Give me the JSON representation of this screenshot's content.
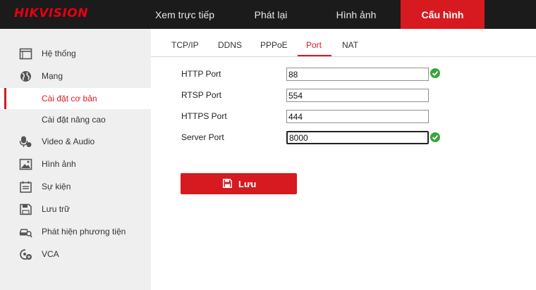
{
  "brand": {
    "logo_text_a": "HIK",
    "logo_text_b": "VISION",
    "accent": "#d71920"
  },
  "topnav": [
    {
      "label": "Xem trực tiếp",
      "active": false
    },
    {
      "label": "Phát lại",
      "active": false
    },
    {
      "label": "Hình ảnh",
      "active": false
    },
    {
      "label": "Cấu hình",
      "active": true
    }
  ],
  "sidebar": {
    "items": [
      {
        "label": "Hệ thống",
        "icon": "system-monitor-icon"
      },
      {
        "label": "Mạng",
        "icon": "globe-icon"
      },
      {
        "label": "Cài đặt cơ bản",
        "icon": "",
        "selected": true
      },
      {
        "label": "Cài đặt nâng cao",
        "icon": ""
      },
      {
        "label": "Video & Audio",
        "icon": "microphone-camera-icon"
      },
      {
        "label": "Hình ảnh",
        "icon": "image-icon"
      },
      {
        "label": "Sự kiện",
        "icon": "calendar-icon"
      },
      {
        "label": "Lưu trữ",
        "icon": "floppy-disk-icon"
      },
      {
        "label": "Phát hiện phương tiện",
        "icon": "car-search-icon"
      },
      {
        "label": "VCA",
        "icon": "vca-settings-icon"
      }
    ]
  },
  "tabs": [
    {
      "label": "TCP/IP",
      "active": false
    },
    {
      "label": "DDNS",
      "active": false
    },
    {
      "label": "PPPoE",
      "active": false
    },
    {
      "label": "Port",
      "active": true
    },
    {
      "label": "NAT",
      "active": false
    }
  ],
  "form": {
    "fields": [
      {
        "label": "HTTP Port",
        "value": "88",
        "valid": true
      },
      {
        "label": "RTSP Port",
        "value": "554",
        "valid": false
      },
      {
        "label": "HTTPS Port",
        "value": "444",
        "valid": false
      },
      {
        "label": "Server Port",
        "value": "8000",
        "valid": true
      }
    ]
  },
  "save_button": {
    "label": "Lưu"
  }
}
